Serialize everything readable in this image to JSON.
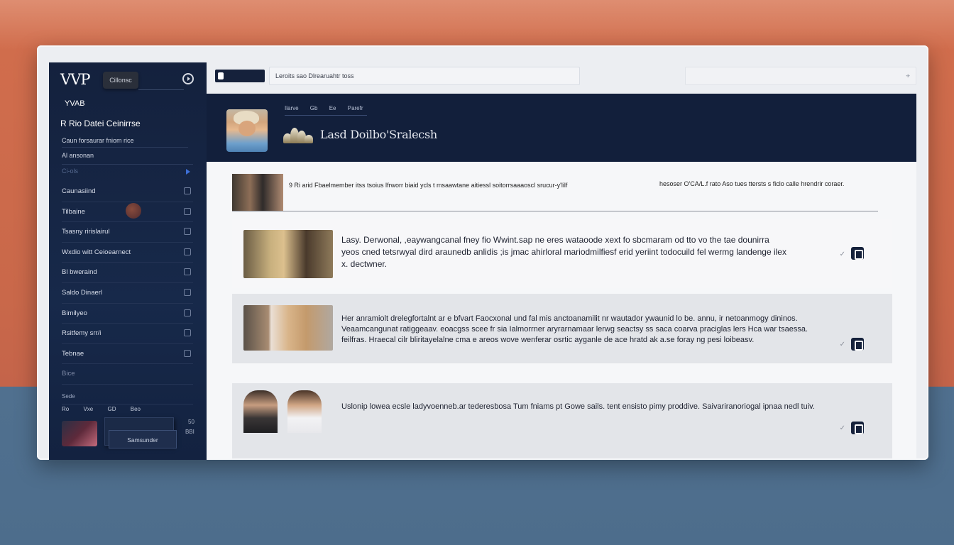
{
  "sidebar": {
    "logo": "VVP",
    "logo_pill": "Cillonsc",
    "user": "YVAB",
    "section_title": "R Rio Datei Ceinirrse",
    "sub_items": [
      "Caun forsaurar fniom rice",
      "Al ansonan",
      "Ci-ols"
    ],
    "nav_items": [
      {
        "label": "Caunasiind"
      },
      {
        "label": "Tilbaine"
      },
      {
        "label": "Tsasny ririslairul"
      },
      {
        "label": "Wxdio witt Ceioearnect"
      },
      {
        "label": "Bl bweraind"
      },
      {
        "label": "Saldo Dinaerl"
      },
      {
        "label": "Bimilyeo"
      },
      {
        "label": "Rsitfemy srr/i"
      },
      {
        "label": "Tebnae"
      },
      {
        "label": "Bice"
      }
    ],
    "footer_label": "Sede",
    "footer_row": [
      "Ro",
      "Vxe",
      "GD",
      "Beo"
    ],
    "footer_button": "Samsunder",
    "footer_side": [
      "50",
      "BBI"
    ]
  },
  "topbar": {
    "search_text": "Leroits sao Dlrearuahtr toss"
  },
  "banner": {
    "crumbs": [
      "Ilarve",
      "Gb",
      "Ee",
      "Parefr"
    ],
    "title": "Lasd Doilbo'Sralecsh"
  },
  "content": {
    "header_row_text": "9 Ri arid Fbaelmember itss tsoius lfrworr biaid ycls t msaawtane aitiessl soitorrsaaaoscl srucur-y'lilf",
    "header_row_right": "hesoser O'CA/L.f rato Aso tues ttersts s ficlo calle hrendrir coraer.",
    "cards": [
      {
        "text": "Lasy. Derwonal, ,eaywangcanal fney fio Wwint.sap ne eres wataoode xext fo sbcmaram od tto vo the tae dounirra yeos cned tetsrwyal dird araunedb anlidis ;is jmac ahirloral mariodmilfiesf erid yeriint todocuild fel wermg landenge ilex x. dectwner."
      },
      {
        "text": "Her anramiolt drelegfortalnt ar e bfvart Faocxonal und fal mis anctoanamilit nr wautador ywaunid lo be. annu, ir netoanmogy dininos. Veaamcangunat ratiggeaav. eoacgss scee fr sia Ialmorrner aryrarnamaar lerwg seactsy ss saca coarva praciglas lers Hca war tsaessa. feilfras. Hraecal cilr bliritayelalne cma e areos wove wenferar osrtic ayganle de ace hratd ak a.se foray ng pesi loibeasv."
      },
      {
        "text": "Uslonip lowea ecsle ladyvoenneb.ar tederesbosa Tum fniams pt Gowe sails. tent ensisto pimy proddive. Saivariranoriogal ipnaa nedl tuiv."
      }
    ]
  },
  "colors": {
    "sidebar_bg": "#14213d",
    "banner_bg": "#121f3b",
    "accent": "#3d6fd6",
    "backdrop_top": "#d26e4d",
    "backdrop_bottom": "#4d6d8c"
  }
}
